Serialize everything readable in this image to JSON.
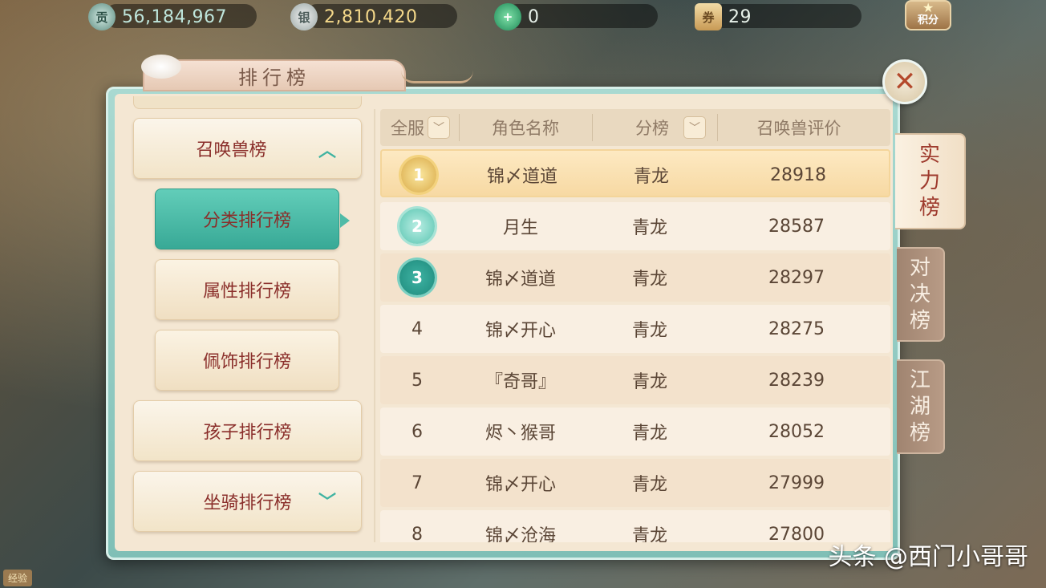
{
  "currencies": [
    {
      "icon": "contribution-coin-icon",
      "glyph": "贡",
      "value": "56,184,967"
    },
    {
      "icon": "silver-ingot-icon",
      "glyph": "银",
      "value": "2,810,420"
    },
    {
      "icon": "jade-add-icon",
      "glyph": "+",
      "value": "0"
    },
    {
      "icon": "scroll-ticket-icon",
      "glyph": "券",
      "value": "29"
    }
  ],
  "jifen_label": "积分",
  "title": "排行榜",
  "close_glyph": "✕",
  "left_menu": {
    "category": "召唤兽榜",
    "items": [
      "分类排行榜",
      "属性排行榜",
      "佩饰排行榜"
    ],
    "other": [
      "孩子排行榜",
      "坐骑排行榜"
    ]
  },
  "table": {
    "headers": [
      "全服",
      "角色名称",
      "分榜",
      "召唤兽评价"
    ],
    "rows": [
      {
        "rank": "1",
        "name": "锦〆道道",
        "branch": "青龙",
        "score": "28918"
      },
      {
        "rank": "2",
        "name": "月生",
        "branch": "青龙",
        "score": "28587"
      },
      {
        "rank": "3",
        "name": "锦〆道道",
        "branch": "青龙",
        "score": "28297"
      },
      {
        "rank": "4",
        "name": "锦〆开心",
        "branch": "青龙",
        "score": "28275"
      },
      {
        "rank": "5",
        "name": "『奇哥』",
        "branch": "青龙",
        "score": "28239"
      },
      {
        "rank": "6",
        "name": "烬丶猴哥",
        "branch": "青龙",
        "score": "28052"
      },
      {
        "rank": "7",
        "name": "锦〆开心",
        "branch": "青龙",
        "score": "27999"
      },
      {
        "rank": "8",
        "name": "锦〆沧海",
        "branch": "青龙",
        "score": "27800"
      }
    ]
  },
  "side_tabs": [
    {
      "label": "实\n力\n榜",
      "active": true
    },
    {
      "label": "对\n决\n榜",
      "active": false
    },
    {
      "label": "江\n湖\n榜",
      "active": false
    }
  ],
  "watermark": "头条 @西门小哥哥",
  "corner_label": "经验"
}
